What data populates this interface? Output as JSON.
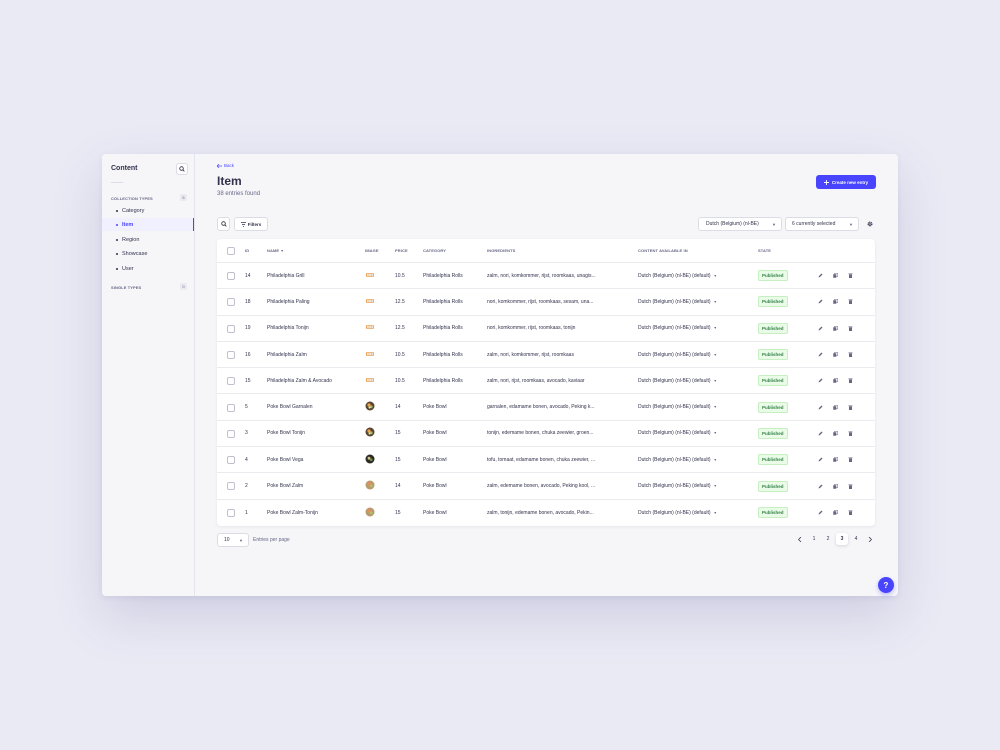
{
  "sidebar": {
    "title": "Content",
    "collection_types_label": "COLLECTION TYPES",
    "collection_types_count": "5",
    "items": [
      {
        "label": "Category"
      },
      {
        "label": "Item"
      },
      {
        "label": "Region"
      },
      {
        "label": "Showcase"
      },
      {
        "label": "User"
      }
    ],
    "single_types_label": "SINGLE TYPES",
    "single_types_count": "0"
  },
  "header": {
    "back_label": "Back",
    "title": "Item",
    "subtitle": "38 entries found",
    "create_button": "Create new entry"
  },
  "toolbar": {
    "filters_label": "Filters",
    "locale_value": "Dutch (Belgium) (nl-BE)",
    "columns_value": "6 currently selected"
  },
  "table": {
    "headers": {
      "id": "ID",
      "name": "NAME",
      "image": "IMAGE",
      "price": "PRICE",
      "category": "CATEGORY",
      "ingredients": "INGREDIENTS",
      "content_available": "CONTENT AVAILABLE IN",
      "state": "STATE"
    },
    "rows": [
      {
        "id": "14",
        "name": "Philadelphia Grill",
        "image": "roll",
        "price": "10.5",
        "category": "Philadelphia Rolls",
        "ingredients": "zalm, nori, komkommer, rijst, roomkaas, unagis...",
        "locale": "Dutch (Belgium) (nl-BE) (default)",
        "state": "Published"
      },
      {
        "id": "18",
        "name": "Philadelphia Paling",
        "image": "roll",
        "price": "12.5",
        "category": "Philadelphia Rolls",
        "ingredients": "nori, komkommer, rijst, roomkaas, sesam, una...",
        "locale": "Dutch (Belgium) (nl-BE) (default)",
        "state": "Published"
      },
      {
        "id": "19",
        "name": "Philadelphia Tonijn",
        "image": "roll",
        "price": "12.5",
        "category": "Philadelphia Rolls",
        "ingredients": "nori, komkommer, rijst, roomkaas, tonijn",
        "locale": "Dutch (Belgium) (nl-BE) (default)",
        "state": "Published"
      },
      {
        "id": "16",
        "name": "Philadelphia Zalm",
        "image": "roll",
        "price": "10.5",
        "category": "Philadelphia Rolls",
        "ingredients": "zalm, nori, komkommer, rijst, roomkaas",
        "locale": "Dutch (Belgium) (nl-BE) (default)",
        "state": "Published"
      },
      {
        "id": "15",
        "name": "Philadelphia Zalm & Avocado",
        "image": "roll",
        "price": "10.5",
        "category": "Philadelphia Rolls",
        "ingredients": "zalm, nori, rijst, roomkaas, avocado, kaviaar",
        "locale": "Dutch (Belgium) (nl-BE) (default)",
        "state": "Published"
      },
      {
        "id": "5",
        "name": "Poke Bowl Garnalen",
        "image": "bowl",
        "price": "14",
        "category": "Poke Bowl",
        "ingredients": "garnalen, edamame bonen, avocado, Peking k...",
        "locale": "Dutch (Belgium) (nl-BE) (default)",
        "state": "Published"
      },
      {
        "id": "3",
        "name": "Poke Bowl Tonijn",
        "image": "bowl",
        "price": "15",
        "category": "Poke Bowl",
        "ingredients": "tonijn, edemame bonen, chuka zeewier, groen...",
        "locale": "Dutch (Belgium) (nl-BE) (default)",
        "state": "Published"
      },
      {
        "id": "4",
        "name": "Poke Bowl Vega",
        "image": "bowl-dark",
        "price": "15",
        "category": "Poke Bowl",
        "ingredients": "tofu, tomaat, edamame bonen, chuka zeewier, ...",
        "locale": "Dutch (Belgium) (nl-BE) (default)",
        "state": "Published"
      },
      {
        "id": "2",
        "name": "Poke Bowl Zalm",
        "image": "bowl-light",
        "price": "14",
        "category": "Poke Bowl",
        "ingredients": "zalm, edemame bonen, avocado, Peking kool, ...",
        "locale": "Dutch (Belgium) (nl-BE) (default)",
        "state": "Published"
      },
      {
        "id": "1",
        "name": "Poke Bowl Zalm-Tonijn",
        "image": "bowl-light",
        "price": "15",
        "category": "Poke Bowl",
        "ingredients": "zalm, tonijn, edemame bonen, avocado, Pekin...",
        "locale": "Dutch (Belgium) (nl-BE) (default)",
        "state": "Published"
      }
    ]
  },
  "footer": {
    "per_page_value": "10",
    "per_page_label": "Entries per page",
    "pages": [
      "1",
      "2",
      "3",
      "4"
    ],
    "active_page": "3"
  },
  "help_label": "?",
  "colors": {
    "accent": "#4945ff",
    "published_bg": "#eafbe7",
    "published_text": "#328048"
  }
}
